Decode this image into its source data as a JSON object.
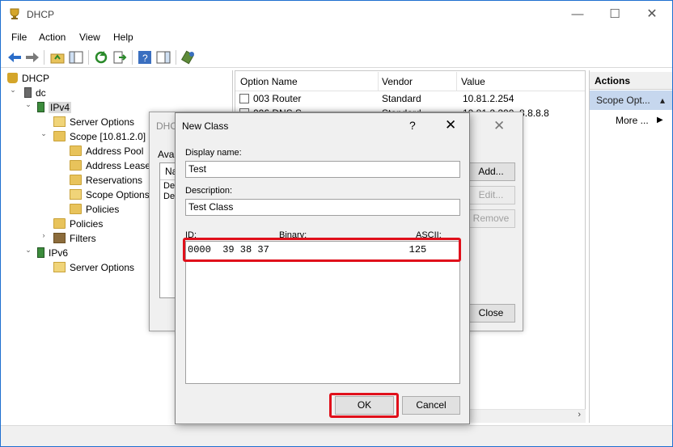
{
  "window": {
    "title": "DHCP"
  },
  "menu": [
    "File",
    "Action",
    "View",
    "Help"
  ],
  "tree": {
    "root": "DHCP",
    "server": "dc",
    "ipv4": "IPv4",
    "ipv4_server_options": "Server Options",
    "scope": "Scope [10.81.2.0] P",
    "address_pool": "Address Pool",
    "address_leases": "Address Leases",
    "reservations": "Reservations",
    "scope_options": "Scope Options",
    "scope_policies": "Policies",
    "ipv4_policies": "Policies",
    "filters": "Filters",
    "ipv6": "IPv6",
    "ipv6_server_options": "Server Options"
  },
  "list": {
    "columns": [
      "Option Name",
      "Vendor",
      "Value"
    ],
    "rows": [
      {
        "name": "003 Router",
        "vendor": "Standard",
        "value": "10.81.2.254"
      },
      {
        "name": "006 DNS S",
        "vendor": "Standard",
        "value": "10.81.2.200, 8.8.8.8"
      }
    ]
  },
  "actions": {
    "header": "Actions",
    "selected": "Scope Opt...",
    "more": "More ..."
  },
  "bg_dialog": {
    "title": "DHC",
    "available_label": "Avai",
    "list_header": "Na",
    "list_items": [
      "Def",
      "Def"
    ],
    "add": "Add...",
    "edit": "Edit...",
    "remove": "Remove",
    "close": "Close"
  },
  "dialog": {
    "title": "New Class",
    "help": "?",
    "close": "✕",
    "display_name_label": "Display name:",
    "display_name_value": "Test",
    "description_label": "Description:",
    "description_value": "Test Class",
    "id_label": "ID:",
    "binary_label": "Binary:",
    "ascii_label": "ASCII:",
    "hex_line": "0000  39 38 37                        125",
    "ok": "OK",
    "cancel": "Cancel"
  },
  "colors": {
    "highlight_red": "#e0101b",
    "action_selected": "#c6d7ee",
    "window_border": "#1e6fd0"
  }
}
